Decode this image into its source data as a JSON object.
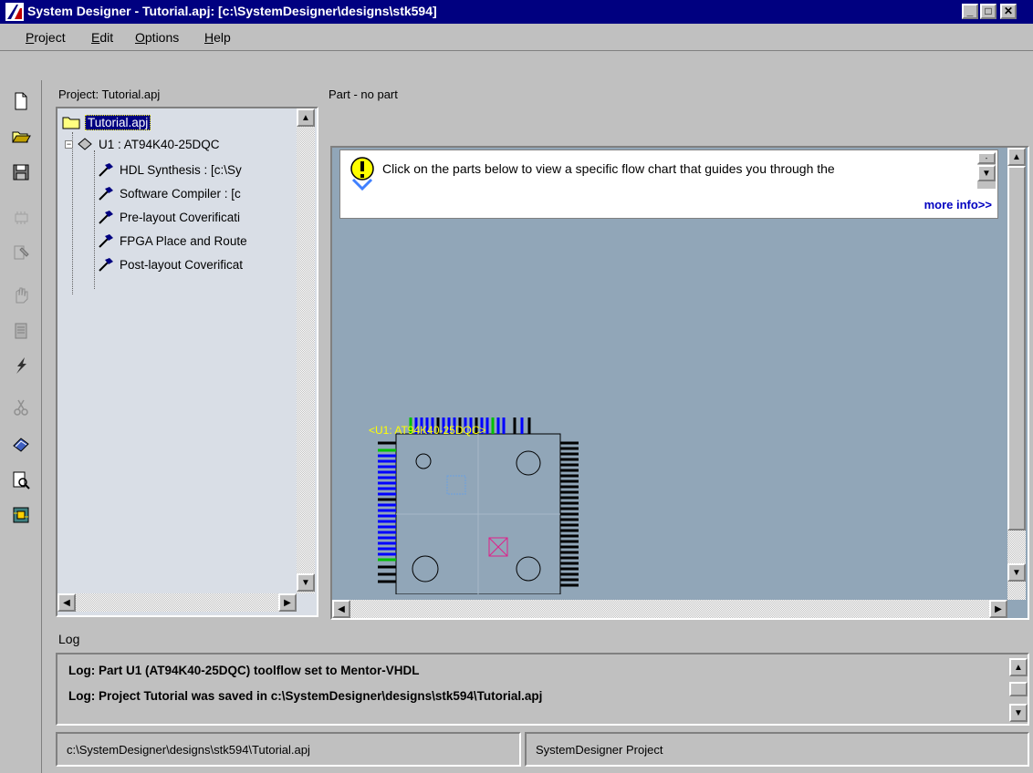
{
  "window": {
    "title": "System Designer - Tutorial.apj: [c:\\SystemDesigner\\designs\\stk594]",
    "minimize": "_",
    "maximize": "□",
    "close": "✕"
  },
  "menu": [
    "Project",
    "Edit",
    "Options",
    "Help"
  ],
  "toolbar": {
    "icons": [
      "new-file-icon",
      "open-folder-icon",
      "save-icon",
      "chip-icon",
      "tools-icon",
      "hand-icon",
      "document-icon",
      "lightning-icon",
      "scissors-icon",
      "book-icon",
      "print-preview-icon",
      "board-icon"
    ]
  },
  "project": {
    "label": "Project: Tutorial.apj",
    "tree": {
      "root": "Tutorial.apj",
      "part": "U1 : AT94K40-25DQC",
      "flows": [
        "HDL Synthesis : [c:\\Sy",
        "Software Compiler : [c",
        "Pre-layout Coverificati",
        "FPGA Place and Route",
        "Post-layout Coverificat"
      ]
    }
  },
  "part": {
    "label": "Part - no part",
    "info_text": "Click on the parts below to view a specific flow chart that guides you through the",
    "more_info": "more info>>",
    "chip_label": "<U1: AT94K40-25DQC>"
  },
  "log": {
    "label": "Log",
    "lines": [
      "Log: Part U1 (AT94K40-25DQC)  toolflow set to Mentor-VHDL",
      "Log: Project Tutorial was saved in c:\\SystemDesigner\\designs\\stk594\\Tutorial.apj"
    ]
  },
  "status": {
    "path": "c:\\SystemDesigner\\designs\\stk594\\Tutorial.apj",
    "type": "SystemDesigner Project"
  },
  "colors": {
    "title_bar": "#000080",
    "tree_bg": "#d9dee6",
    "part_bg": "#91a6b8",
    "link": "#0000c0",
    "pin_blue": "#0000ff",
    "pin_green": "#00e000"
  }
}
